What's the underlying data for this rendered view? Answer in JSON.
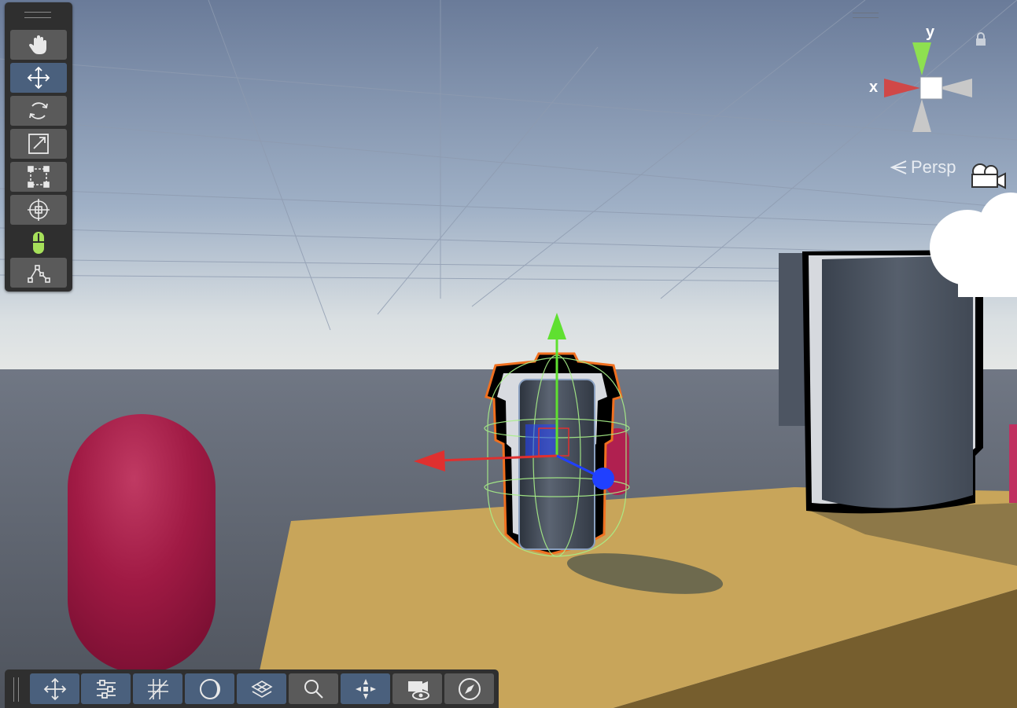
{
  "scene_view": {
    "projection_label": "Persp",
    "orientation_gizmo": {
      "x_label": "x",
      "y_label": "y"
    }
  },
  "tools_panel": {
    "tools": [
      {
        "id": "view",
        "icon": "hand-icon",
        "active": false
      },
      {
        "id": "move",
        "icon": "move-arrows-icon",
        "active": true
      },
      {
        "id": "rotate",
        "icon": "rotate-icon",
        "active": false
      },
      {
        "id": "scale",
        "icon": "scale-icon",
        "active": false
      },
      {
        "id": "rect",
        "icon": "rect-transform-icon",
        "active": false
      },
      {
        "id": "transform",
        "icon": "transform-icon",
        "active": false
      },
      {
        "id": "custom-editor",
        "icon": "mouse-icon",
        "active": false
      },
      {
        "id": "custom-tool",
        "icon": "path-icon",
        "active": false
      }
    ]
  },
  "bottom_toolbar": {
    "buttons": [
      {
        "icon": "move-arrows-icon",
        "active": true
      },
      {
        "icon": "settings-sliders-icon",
        "active": true
      },
      {
        "icon": "grid-snap-icon",
        "active": true
      },
      {
        "icon": "shading-sphere-icon",
        "active": true
      },
      {
        "icon": "layers-icon",
        "active": true
      },
      {
        "icon": "search-icon",
        "active": false
      },
      {
        "icon": "scene-gizmo-icon",
        "active": true
      },
      {
        "icon": "camera-visibility-icon",
        "active": false
      },
      {
        "icon": "compass-icon",
        "active": false
      }
    ]
  },
  "colors": {
    "accent": "#4a607d",
    "panel": "#2f2f2f",
    "button": "#5a5a5a",
    "x_axis": "#e0302f",
    "y_axis": "#5fe030",
    "z_axis": "#2040ff",
    "selection_outline": "#f07020",
    "ground": "#c8a55a",
    "capsule": "#a01a44"
  }
}
